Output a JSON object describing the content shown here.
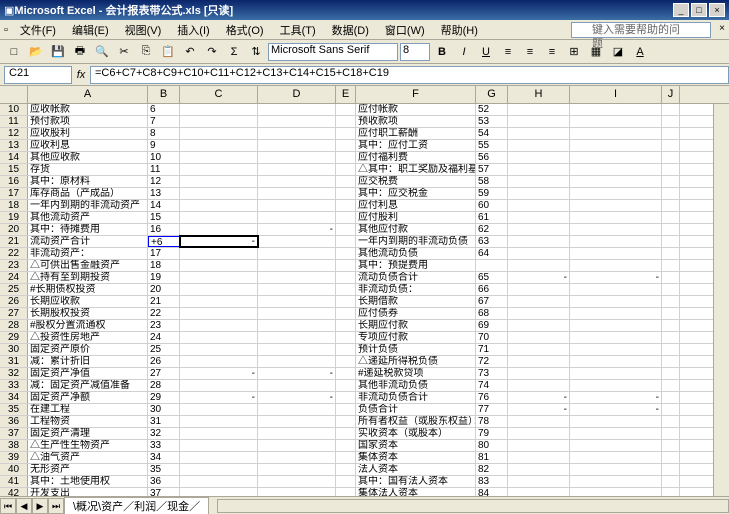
{
  "app": {
    "title": "Microsoft Excel - 会计报表带公式.xls  [只读]",
    "help_hint": "键入需要帮助的问题"
  },
  "menu": {
    "items": [
      "文件(F)",
      "编辑(E)",
      "视图(V)",
      "插入(I)",
      "格式(O)",
      "工具(T)",
      "数据(D)",
      "窗口(W)",
      "帮助(H)"
    ]
  },
  "toolbar": {
    "font_name": "Microsoft Sans Serif",
    "font_size": "8"
  },
  "formula_bar": {
    "cell_ref": "C21",
    "formula": "=C6+C7+C8+C9+C10+C11+C12+C13+C14+C15+C18+C19"
  },
  "columns": [
    "A",
    "B",
    "C",
    "D",
    "E",
    "F",
    "G",
    "H",
    "I",
    "J"
  ],
  "rows": [
    {
      "n": 10,
      "A": "应收帐款",
      "B": "6",
      "F": "应付帐款",
      "G": "52"
    },
    {
      "n": 11,
      "A": "预付款项",
      "B": "7",
      "F": "预收款项",
      "G": "53"
    },
    {
      "n": 12,
      "A": "应收股利",
      "B": "8",
      "F": "应付职工薪酬",
      "G": "54"
    },
    {
      "n": 13,
      "A": "应收利息",
      "B": "9",
      "F": "其中：应付工资",
      "G": "55"
    },
    {
      "n": 14,
      "A": "其他应收款",
      "B": "10",
      "F": "应付福利费",
      "G": "56"
    },
    {
      "n": 15,
      "A": "存货",
      "B": "11",
      "F": "△其中：职工奖励及福利基金",
      "G": "57"
    },
    {
      "n": 16,
      "A": "其中：原材料",
      "B": "12",
      "F": "应交税费",
      "G": "58"
    },
    {
      "n": 17,
      "A": "库存商品（产成品）",
      "B": "13",
      "F": "其中：应交税金",
      "G": "59"
    },
    {
      "n": 18,
      "A": "一年内到期的非流动资产",
      "B": "14",
      "F": "应付利息",
      "G": "60"
    },
    {
      "n": 19,
      "A": "其他流动资产",
      "B": "15",
      "F": "应付股利",
      "G": "61"
    },
    {
      "n": 20,
      "A": "其中：待摊费用",
      "B": "16",
      "D": "-",
      "F": "其他应付款",
      "G": "62"
    },
    {
      "n": 21,
      "A": "流动资产合计",
      "B": "+6",
      "C": "-",
      "active": true,
      "F": "一年内到期的非流动负债",
      "G": "63"
    },
    {
      "n": 22,
      "A": "非流动资产：",
      "B": "17",
      "F": "其他流动负债",
      "G": "64"
    },
    {
      "n": 23,
      "A": "△可供出售金融资产",
      "B": "18",
      "F": "其中：预提费用",
      "G": ""
    },
    {
      "n": 24,
      "A": "△持有至到期投资",
      "B": "19",
      "F": "流动负债合计",
      "G": "65",
      "H": "-",
      "I": "-"
    },
    {
      "n": 25,
      "A": "#长期债权投资",
      "B": "20",
      "F": "非流动负债：",
      "G": "66"
    },
    {
      "n": 26,
      "A": "长期应收款",
      "B": "21",
      "F": "长期借款",
      "G": "67"
    },
    {
      "n": 27,
      "A": "长期股权投资",
      "B": "22",
      "F": "应付债券",
      "G": "68"
    },
    {
      "n": 28,
      "A": "#股权分置流通权",
      "B": "23",
      "F": "长期应付款",
      "G": "69"
    },
    {
      "n": 29,
      "A": "△投资性房地产",
      "B": "24",
      "F": "专项应付款",
      "G": "70"
    },
    {
      "n": 30,
      "A": "固定资产原价",
      "B": "25",
      "F": "预计负债",
      "G": "71"
    },
    {
      "n": 31,
      "A": "减：累计折旧",
      "B": "26",
      "F": "△递延所得税负债",
      "G": "72"
    },
    {
      "n": 32,
      "A": "固定资产净值",
      "B": "27",
      "C": "-",
      "D": "-",
      "F": "#递延税款贷项",
      "G": "73"
    },
    {
      "n": 33,
      "A": "减：固定资产减值准备",
      "B": "28",
      "F": "其他非流动负债",
      "G": "74"
    },
    {
      "n": 34,
      "A": "固定资产净额",
      "B": "29",
      "C": "-",
      "D": "-",
      "F": "非流动负债合计",
      "G": "76",
      "H": "-",
      "I": "-"
    },
    {
      "n": 35,
      "A": "在建工程",
      "B": "30",
      "F": "负债合计",
      "G": "77",
      "H": "-",
      "I": "-"
    },
    {
      "n": 36,
      "A": "工程物资",
      "B": "31",
      "F": "所有者权益（或股东权益）：",
      "G": "78"
    },
    {
      "n": 37,
      "A": "固定资产清理",
      "B": "32",
      "F": "实收资本（或股本）",
      "G": "79"
    },
    {
      "n": 38,
      "A": "△生产性生物资产",
      "B": "33",
      "F": "国家资本",
      "G": "80"
    },
    {
      "n": 39,
      "A": "△油气资产",
      "B": "34",
      "F": "集体资本",
      "G": "81"
    },
    {
      "n": 40,
      "A": "无形资产",
      "B": "35",
      "F": "法人资本",
      "G": "82"
    },
    {
      "n": 41,
      "A": "其中：土地使用权",
      "B": "36",
      "F": "其中：国有法人资本",
      "G": "83"
    },
    {
      "n": 42,
      "A": "开发支出",
      "B": "37",
      "F": "集体法人资本",
      "G": "84"
    }
  ],
  "sheets": {
    "active": "\\概况\\资产／利润／现金／"
  },
  "chart_data": null
}
